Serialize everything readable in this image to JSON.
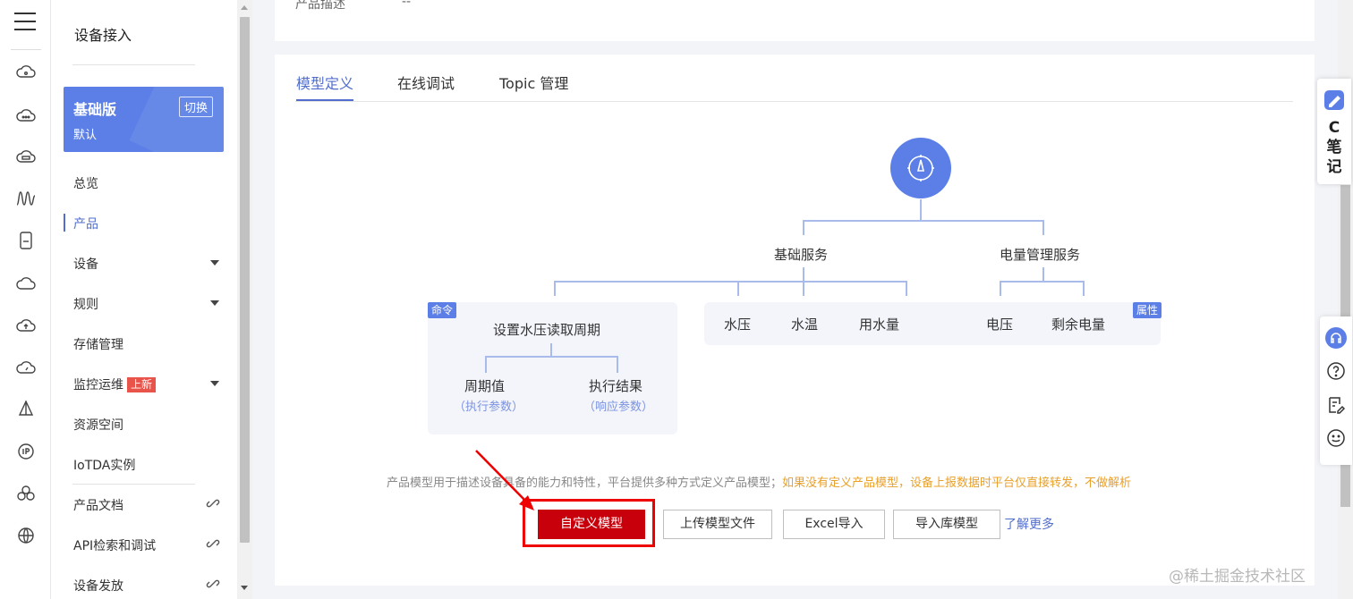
{
  "rail": {
    "icons": [
      "menu-icon",
      "cloud-icon",
      "cloud-dots-icon",
      "cloud-server-icon",
      "waveform-icon",
      "device-icon",
      "cloud-outline-icon",
      "cloud-upload-icon",
      "cloud-gauge-icon",
      "pyramid-icon",
      "ip-icon",
      "cluster-icon",
      "globe-icon"
    ]
  },
  "sidebar": {
    "title": "设备接入",
    "edition": {
      "name": "基础版",
      "sub": "默认",
      "switch": "切换"
    },
    "items": [
      {
        "label": "总览"
      },
      {
        "label": "产品",
        "active": true
      },
      {
        "label": "设备"
      },
      {
        "label": "规则"
      },
      {
        "label": "存储管理"
      },
      {
        "label": "监控运维",
        "badge": "上新"
      },
      {
        "label": "资源空间"
      },
      {
        "label": "IoTDA实例"
      },
      {
        "label": "产品文档"
      },
      {
        "label": "API检索和调试"
      },
      {
        "label": "设备发放"
      }
    ]
  },
  "product": {
    "desc_label": "产品描述",
    "desc_value": "--"
  },
  "tabs": [
    {
      "label": "模型定义",
      "active": true
    },
    {
      "label": "在线调试"
    },
    {
      "label": "Topic 管理"
    }
  ],
  "diagram": {
    "services": [
      "基础服务",
      "电量管理服务"
    ],
    "command_tag": "命令",
    "property_tag": "属性",
    "command": "设置水压读取周期",
    "command_params": [
      {
        "name": "周期值",
        "sub": "（执行参数）"
      },
      {
        "name": "执行结果",
        "sub": "（响应参数）"
      }
    ],
    "basic_props": [
      "水压",
      "水温",
      "用水量"
    ],
    "power_props": [
      "电压",
      "剩余电量"
    ]
  },
  "info": {
    "text": "产品模型用于描述设备具备的能力和特性，平台提供多种方式定义产品模型；",
    "warning": "如果没有定义产品模型，设备上报数据时平台仅直接转发，不做解析"
  },
  "buttons": {
    "custom": "自定义模型",
    "upload": "上传模型文件",
    "excel": "Excel导入",
    "library": "导入库模型",
    "learn_more": "了解更多"
  },
  "note_tab": {
    "text": "C笔记"
  },
  "watermark": "@稀土掘金技术社区",
  "colors": {
    "primary": "#526ecc",
    "brand_red": "#c7000b",
    "warning": "#e8a02b",
    "accent_blue": "#5b7fe6"
  }
}
